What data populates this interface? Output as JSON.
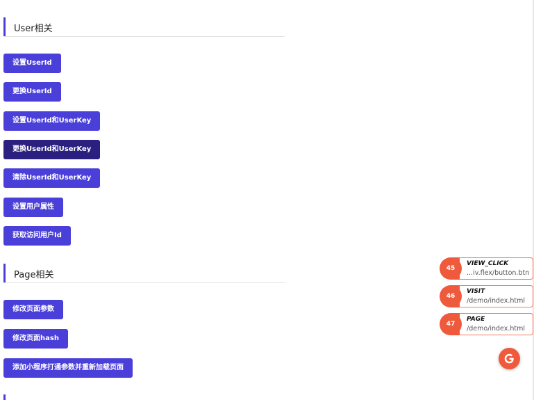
{
  "sections": {
    "user": {
      "title": "User相关",
      "buttons": [
        "设置UserId",
        "更换UserId",
        "设置UserId和UserKey",
        "更换UserId和UserKey",
        "清除UserId和UserKey",
        "设置用户属性",
        "获取访问用户Id"
      ]
    },
    "page": {
      "title": "Page相关",
      "buttons": [
        "修改页面参数",
        "修改页面hash",
        "添加小程序打通参数并重新加载页面"
      ]
    }
  },
  "events": [
    {
      "id": "45",
      "type": "VIEW_CLICK",
      "path": "...iv.flex/button.btn"
    },
    {
      "id": "46",
      "type": "VISIT",
      "path": "/demo/index.html"
    },
    {
      "id": "47",
      "type": "PAGE",
      "path": "/demo/index.html"
    }
  ],
  "colors": {
    "primary": "#4a3fd8",
    "active": "#2b1f7f",
    "accent": "#ef5a3c"
  },
  "icons": {
    "floating_button": "g-logo-icon"
  }
}
